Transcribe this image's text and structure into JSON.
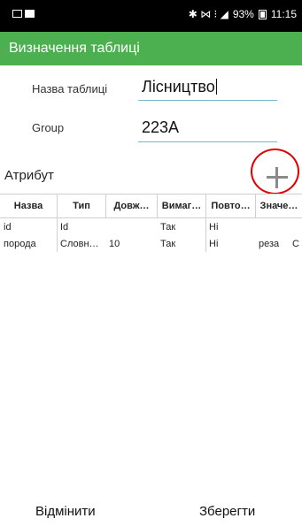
{
  "status_bar": {
    "signal": "✱ ⋈ ⁝ ◢",
    "battery": "93%",
    "time": "11:15"
  },
  "app_bar": {
    "title": "Визначення таблиці"
  },
  "form": {
    "table_name_label": "Назва таблиці",
    "table_name_value": "Лісництво",
    "group_label": "Group",
    "group_value": "223A"
  },
  "attributes": {
    "section_label": "Атрибут",
    "add_icon": "plus-icon",
    "annotation_color": "#e00000",
    "columns": [
      "Назва",
      "Тип",
      "Довж…",
      "Вимаг…",
      "Повто…",
      "Значе…"
    ],
    "rows": [
      [
        "id",
        "Id",
        "",
        "Так",
        "Ні",
        "",
        ""
      ],
      [
        "порода",
        "Словн…",
        "10",
        "Так",
        "Ні",
        "реза",
        "С"
      ]
    ]
  },
  "footer": {
    "cancel_label": "Відмінити",
    "save_label": "Зберегти"
  },
  "colors": {
    "accent": "#4caf50",
    "underline": "#7ab5c8",
    "status_bar": "#000000"
  }
}
